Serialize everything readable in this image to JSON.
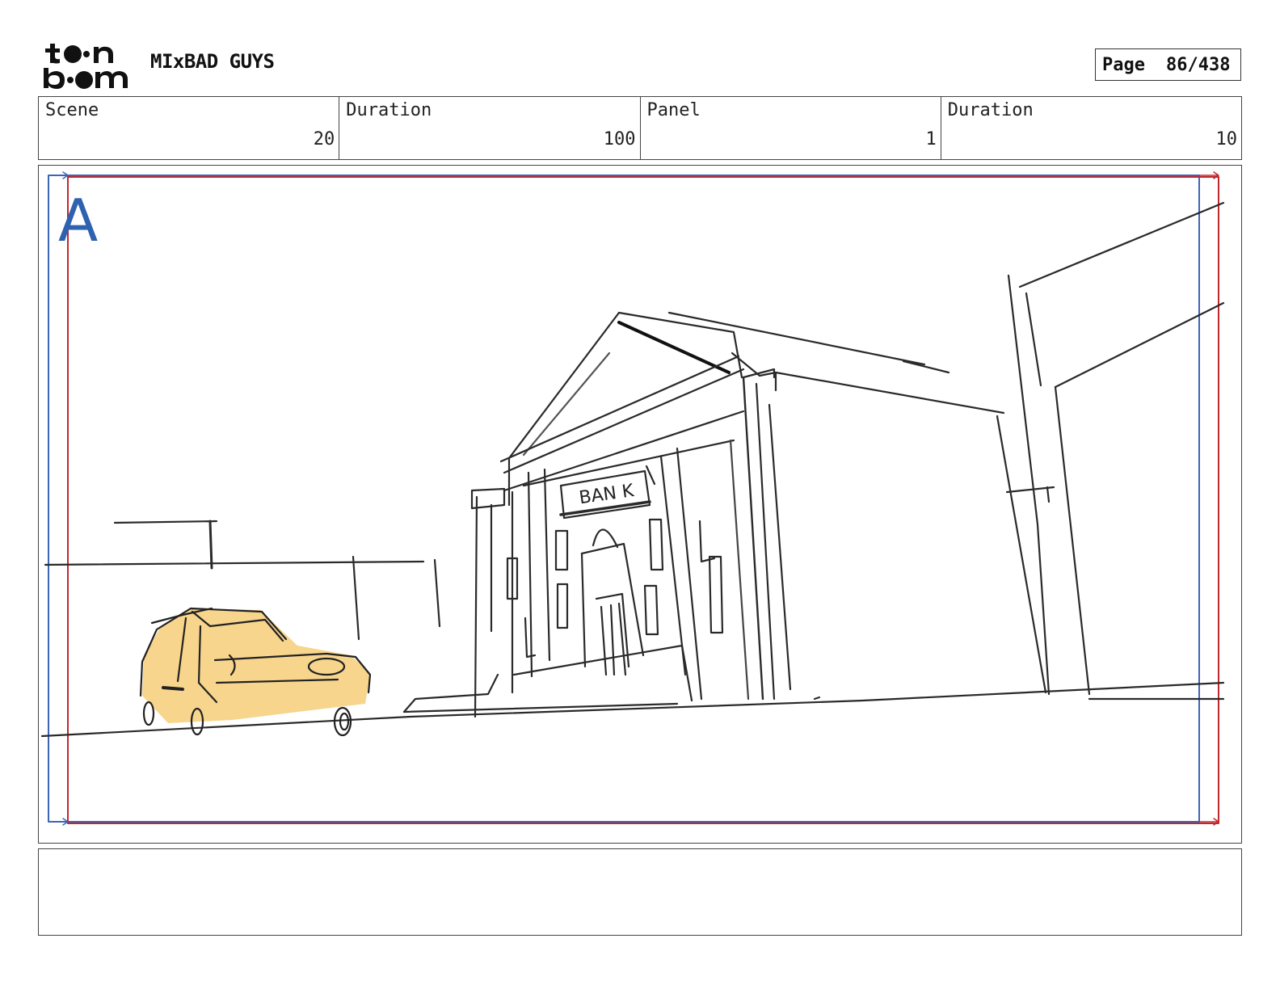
{
  "header": {
    "logo_text": "toon boom",
    "project_title": "MIxBAD GUYS",
    "page_label": "Page",
    "page_number": "86/438"
  },
  "info": {
    "scene_label": "Scene",
    "scene_value": "20",
    "scene_duration_label": "Duration",
    "scene_duration_value": "100",
    "panel_label": "Panel",
    "panel_value": "1",
    "panel_duration_label": "Duration",
    "panel_duration_value": "10"
  },
  "panel": {
    "label": "A",
    "sign_text": "BAN K",
    "colors": {
      "safe_frame_blue": "#3b66b5",
      "camera_frame_red": "#c0282e",
      "car_fill": "#f7d58c",
      "sketch_stroke": "#2a2a2a"
    }
  },
  "notes": {
    "text": ""
  }
}
